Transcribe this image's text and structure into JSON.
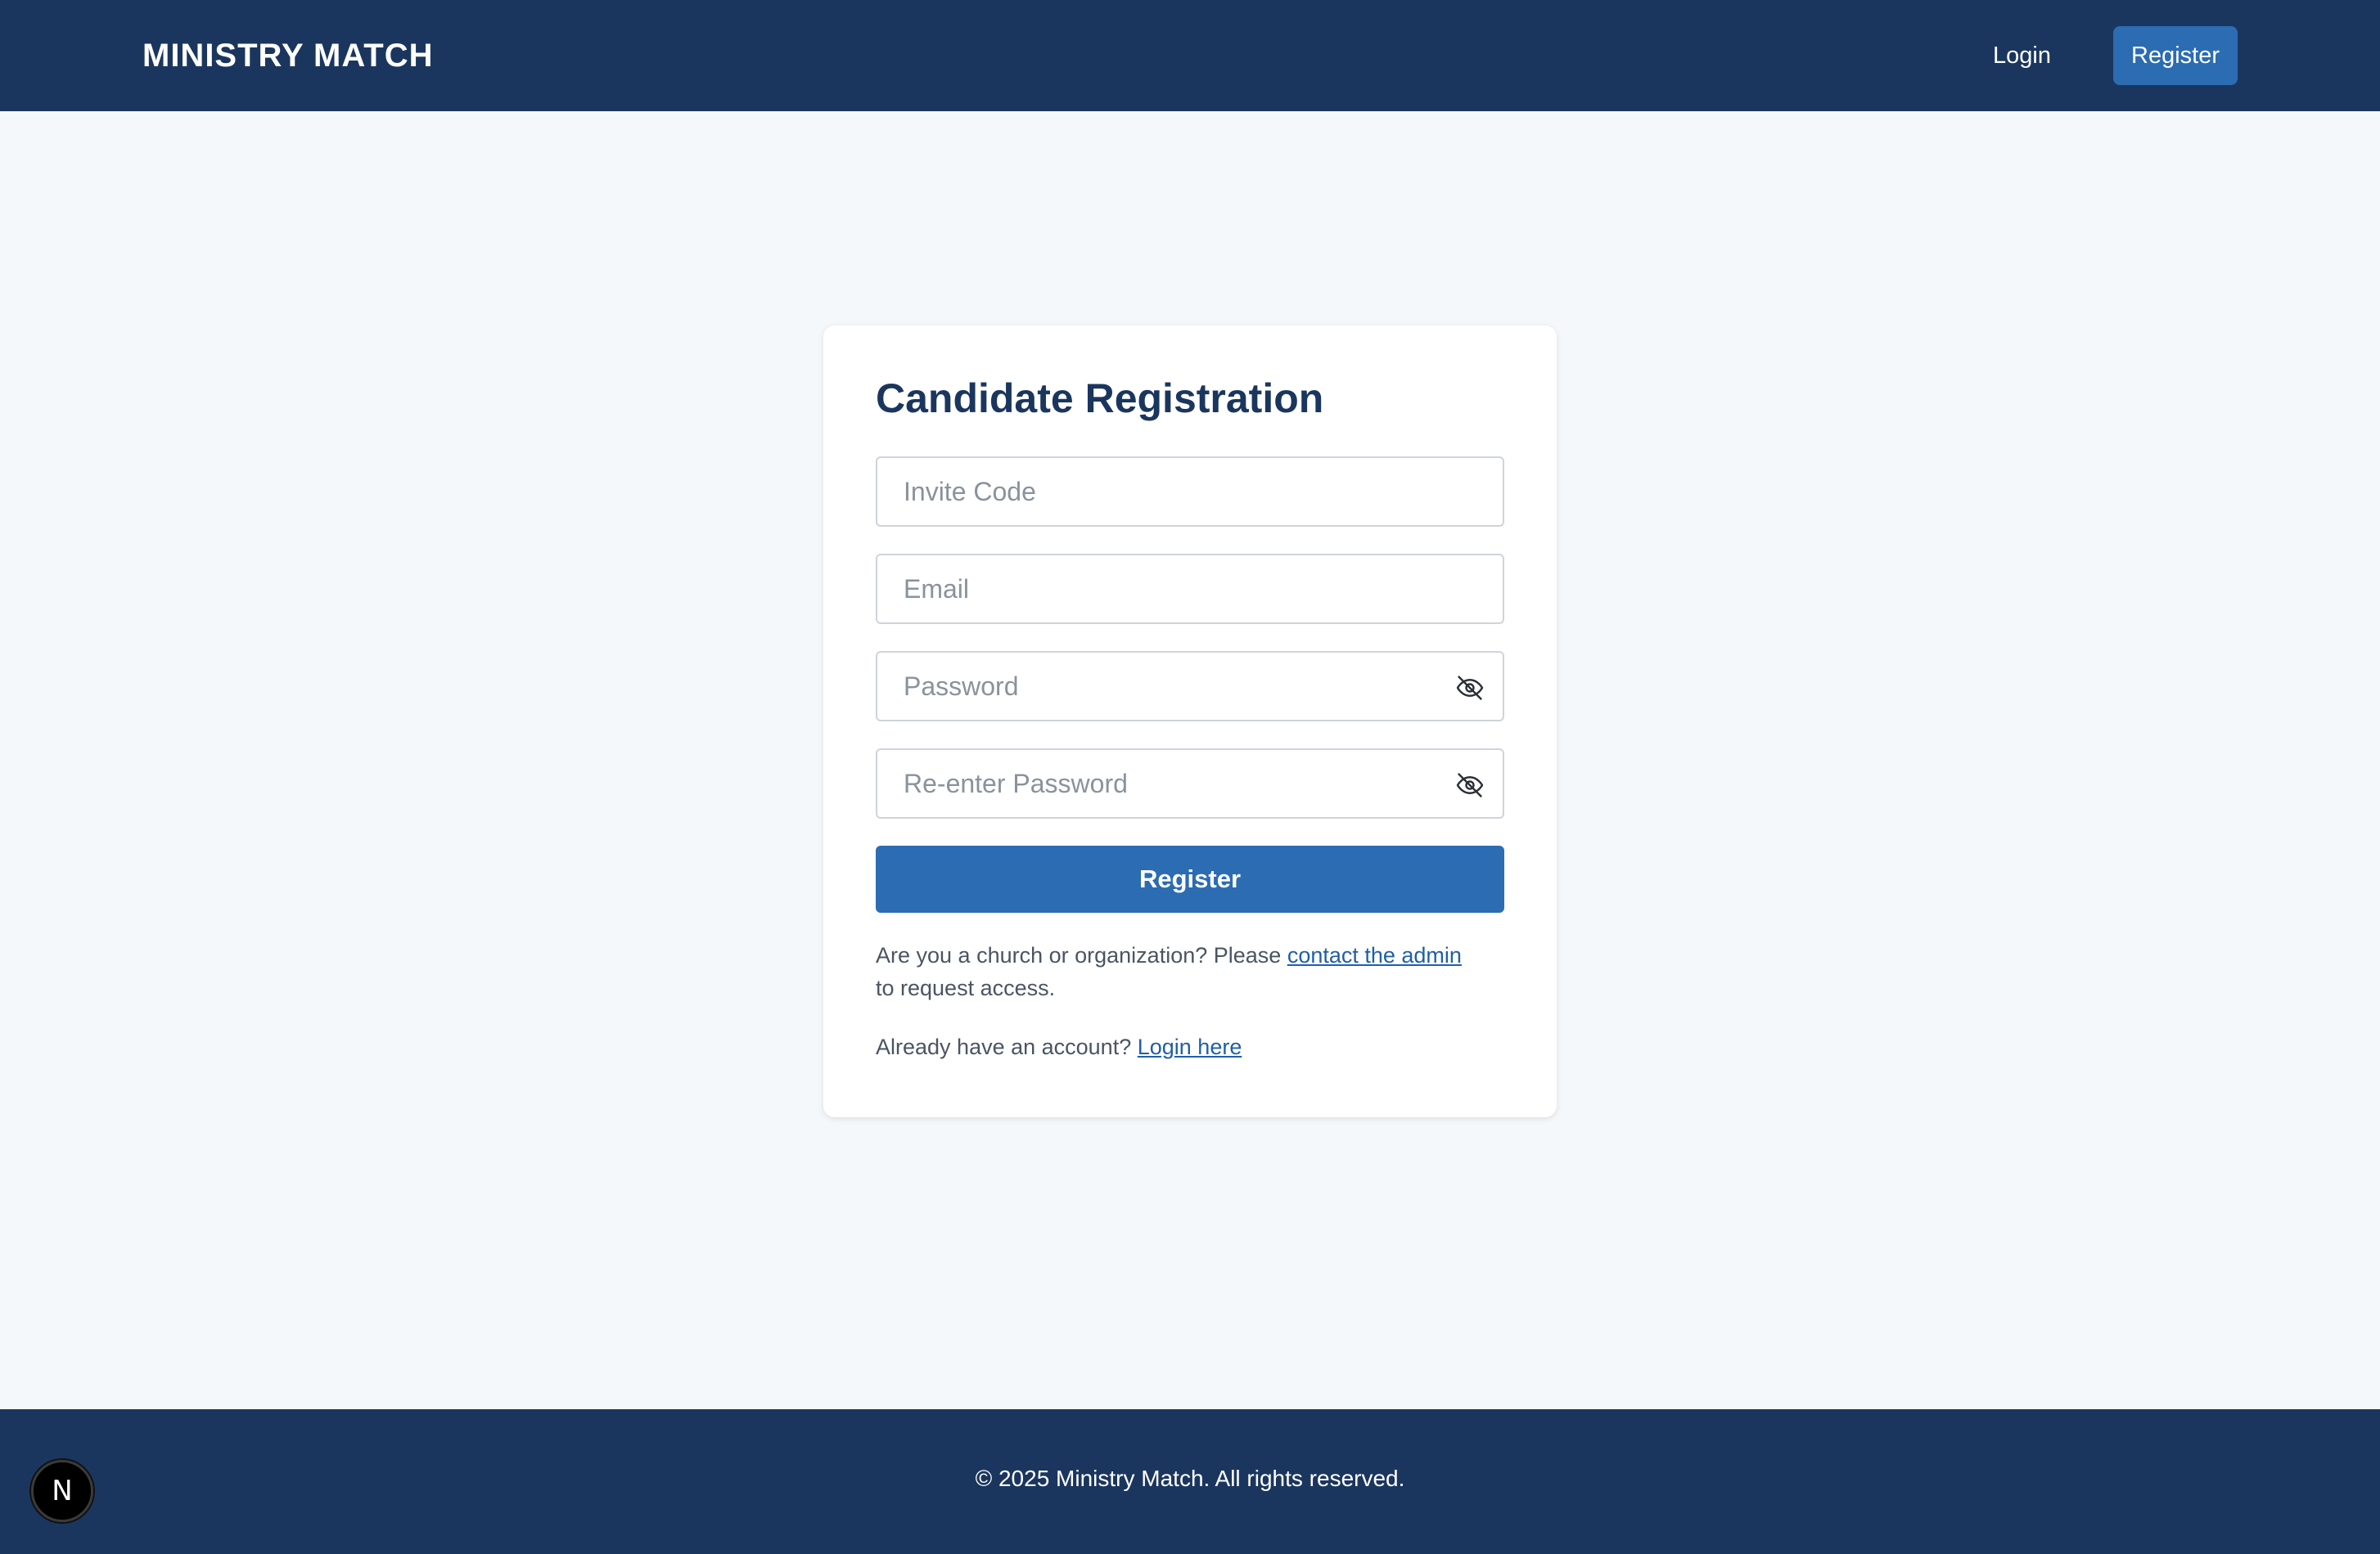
{
  "header": {
    "brand": "MINISTRY MATCH",
    "nav_login": "Login",
    "nav_register": "Register"
  },
  "form": {
    "title": "Candidate Registration",
    "invite_code": {
      "placeholder": "Invite Code",
      "value": ""
    },
    "email": {
      "placeholder": "Email",
      "value": ""
    },
    "password": {
      "placeholder": "Password",
      "value": "",
      "toggle_icon": "eye-off-icon"
    },
    "confirm_password": {
      "placeholder": "Re-enter Password",
      "value": "",
      "toggle_icon": "eye-off-icon"
    },
    "submit_label": "Register",
    "org_note_prefix": "Are you a church or organization? Please",
    "org_note_link": "contact the admin",
    "org_note_suffix": "to request access.",
    "login_prompt": "Already have an account?",
    "login_link": "Login here"
  },
  "footer": {
    "copyright": "© 2025 Ministry Match. All rights reserved."
  },
  "dev_badge": {
    "label": "N",
    "icon": "nextjs-logo-icon"
  },
  "colors": {
    "header_bg": "#1b365e",
    "accent": "#2b6cb3",
    "page_bg": "#f4f8fb",
    "link": "#1f5fa8"
  }
}
